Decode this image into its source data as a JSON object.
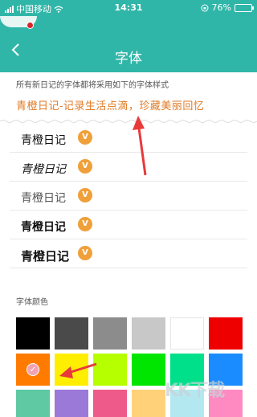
{
  "status_bar": {
    "carrier": "中国移动",
    "time": "14:31",
    "battery_percent": "76%",
    "battery_level": 0.76
  },
  "header": {
    "title": "字体"
  },
  "description": "所有新日记的字体都将采用如下的字体样式",
  "preview_text": "青橙日记-记录生活点滴，珍藏美丽回忆",
  "fonts": [
    {
      "name": "青橙日记",
      "badge": "V"
    },
    {
      "name": "青橙日记",
      "badge": "V"
    },
    {
      "name": "青橙日记",
      "badge": "V"
    },
    {
      "name": "青橙日记",
      "badge": "V"
    },
    {
      "name": "青橙日记",
      "badge": "V"
    }
  ],
  "color_section_label": "字体颜色",
  "colors": [
    "#000000",
    "#4a4a4a",
    "#8c8c8c",
    "#c8c8c8",
    "#ffffff",
    "#ee0000",
    "#ff7b00",
    "#ffee00",
    "#b6ff00",
    "#00e600",
    "#00e08a",
    "#1a8cff",
    "#5ec9a3",
    "#9a79d8",
    "#ee5a8a",
    "#ffd27a",
    "#b4e8f0",
    "#ff8ac2"
  ],
  "selected_color_index": 6,
  "icons": {
    "back": "chevron-left-icon",
    "wifi": "wifi-icon",
    "lock": "rotation-lock-icon",
    "check": "checkmark-icon"
  },
  "watermark": "KK下载"
}
